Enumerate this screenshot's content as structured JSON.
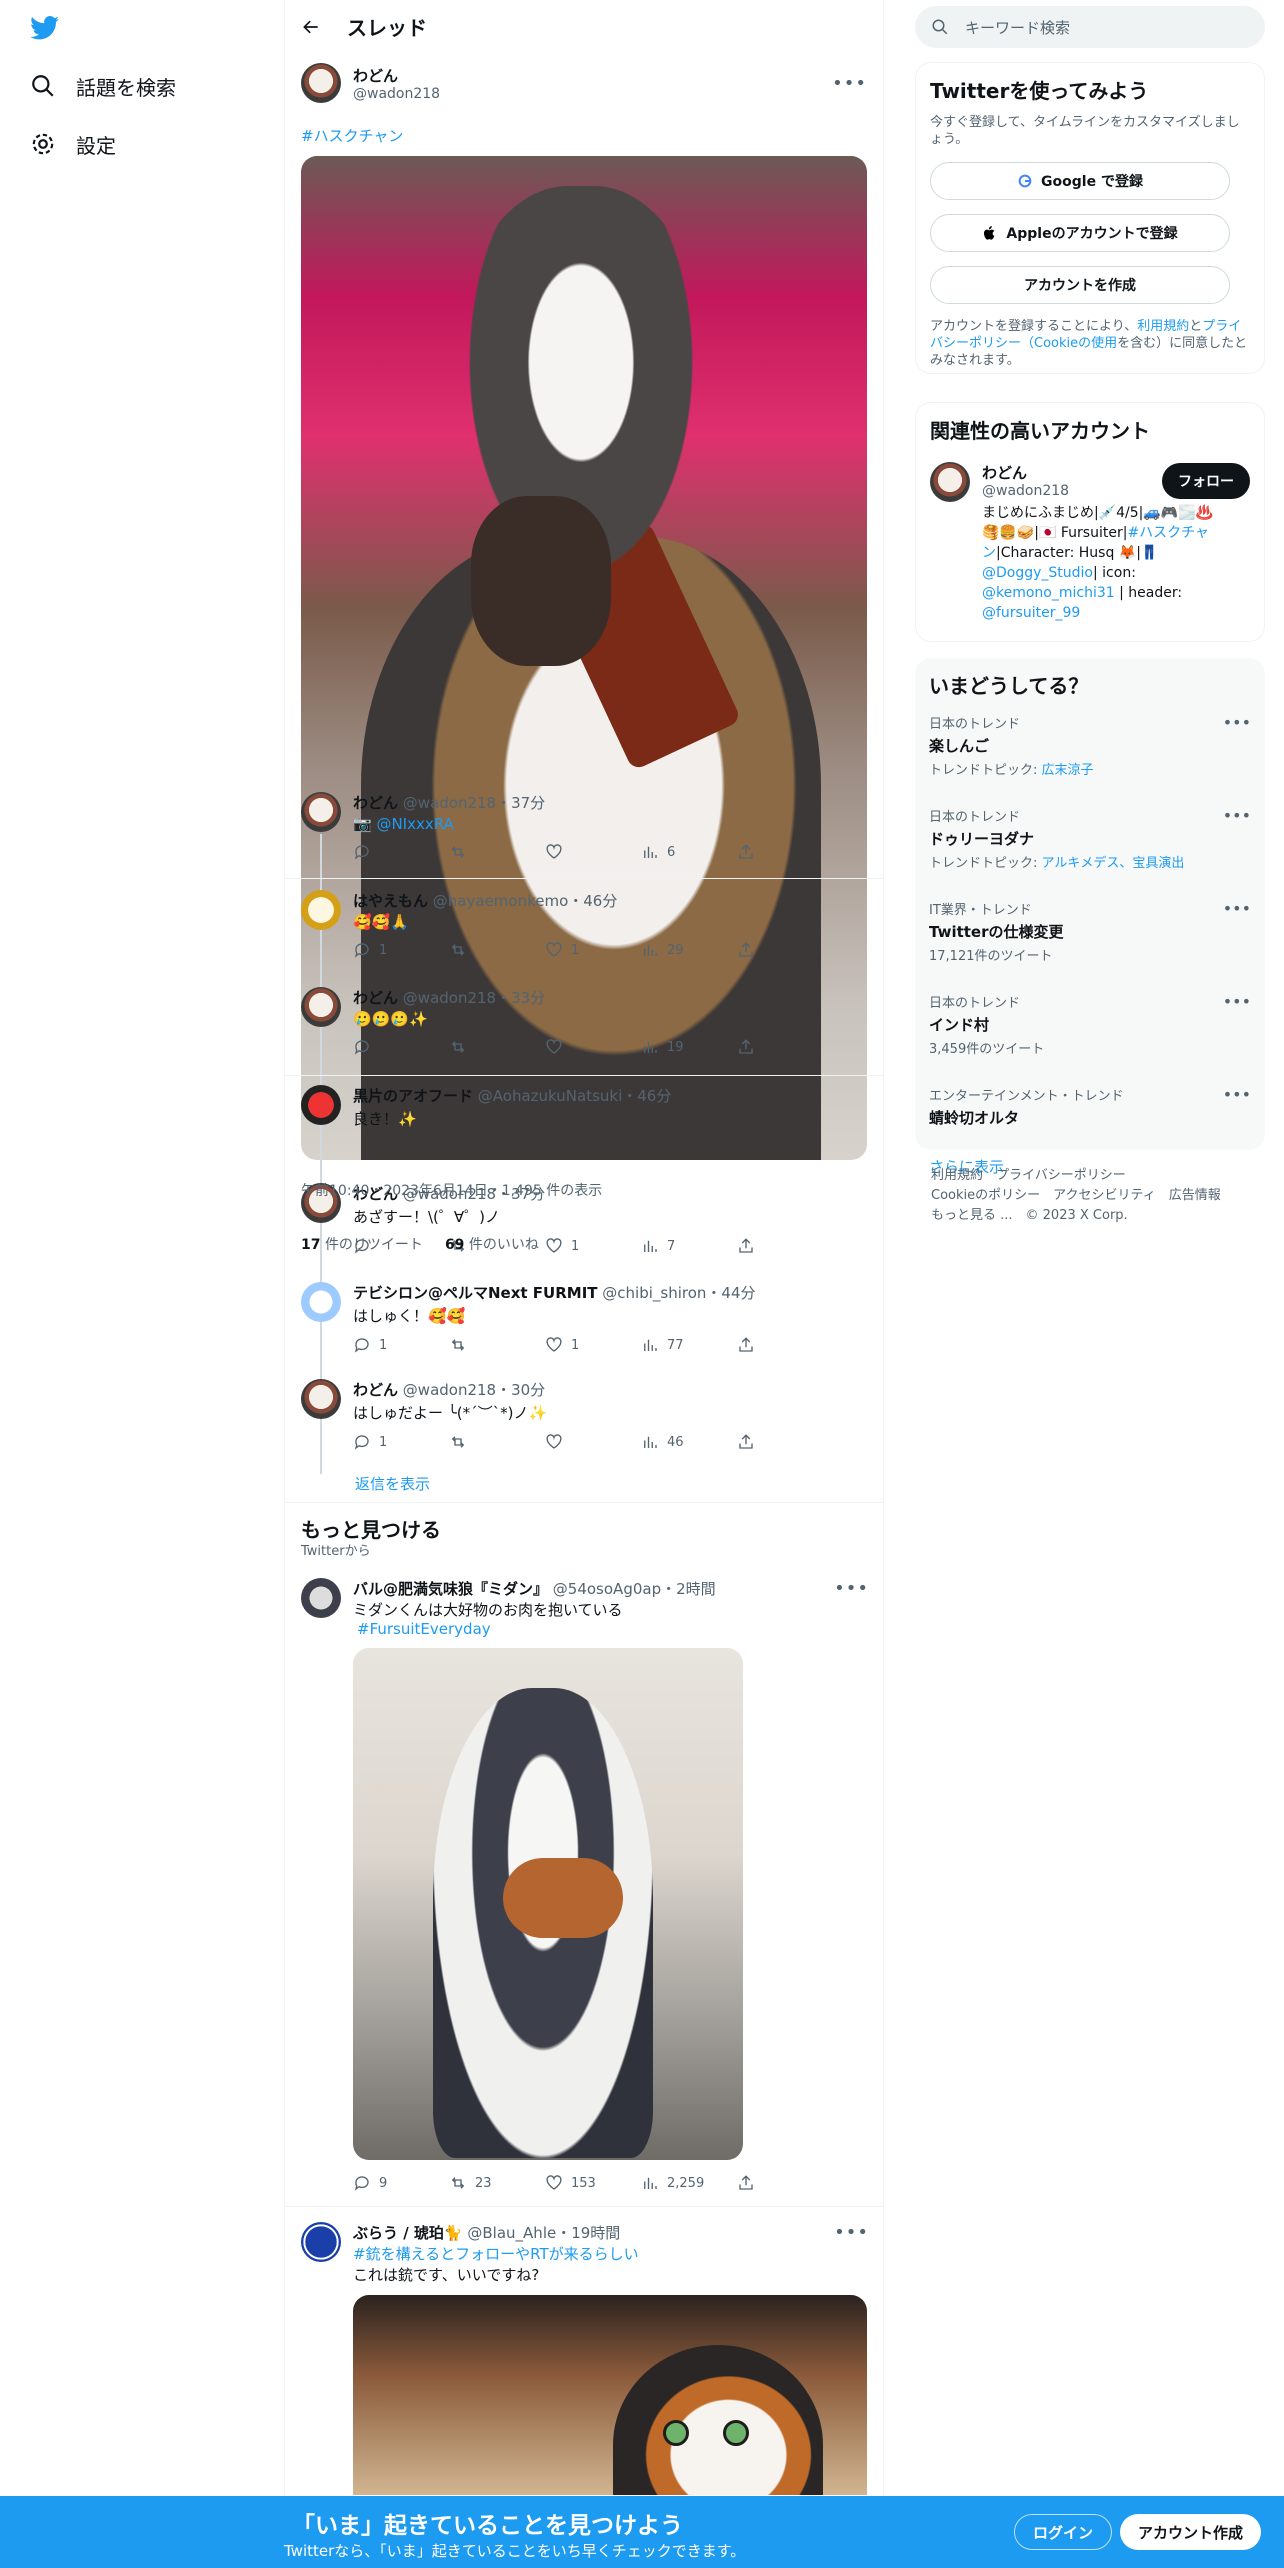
{
  "nav": {
    "explore_label": "話題を検索",
    "settings_label": "設定"
  },
  "thread": {
    "title": "スレッド",
    "author_name": "わどん",
    "author_handle": "@wadon218",
    "hashtag": "#ハスクチャン",
    "timestamp": "午前10:40・2023年6月14日・1,495 件の表示",
    "retweets_count": "17",
    "retweets_label": "件のリツイート",
    "likes_count": "69",
    "likes_label": "件のいいね"
  },
  "replies": [
    {
      "name": "わどん",
      "meta": "@wadon218・37分",
      "text": "📷 @NIxxxRA",
      "reply": "",
      "like": "",
      "views": "6"
    },
    {
      "name": "はやえもん",
      "meta": "@hayaemonkemo・46分",
      "text": "🥰🥰🙏",
      "reply": "1",
      "like": "1",
      "views": "29"
    },
    {
      "name": "わどん",
      "meta": "@wadon218・33分",
      "text": "🥲🥲🥲✨",
      "reply": "",
      "like": "",
      "views": "19"
    },
    {
      "name": "黒片のアオフード",
      "meta": "@AohazukuNatsuki・46分",
      "text": "良き！✨",
      "reply": "",
      "like": "",
      "views": ""
    },
    {
      "name": "わどん",
      "meta": "@wadon218・37分",
      "text": "あざすー！\\(゜∀゜)ノ",
      "reply": "",
      "like": "1",
      "views": "7"
    },
    {
      "name": "テビシロン@ペルマNext FURMIT",
      "meta": "@chibi_shiron・44分",
      "text": "はしゅく！🥰🥰",
      "reply": "1",
      "like": "1",
      "views": "77"
    },
    {
      "name": "わどん",
      "meta": "@wadon218・30分",
      "text": "はしゅだよー ╰(*´︶`*)ノ✨",
      "reply": "1",
      "like": "",
      "views": "46"
    }
  ],
  "show_replies": "返信を表示",
  "discover": {
    "title": "もっと見つける",
    "subtitle": "Twitterから",
    "tweets": [
      {
        "name": "バル@肥満気味狼『ミダン』",
        "meta": "@54osoAg0ap・2時間",
        "text": "ミダンくんは大好物のお肉を抱いている",
        "tag": "#FursuitEveryday",
        "reply": "9",
        "retweet": "23",
        "like": "153",
        "views": "2,259"
      },
      {
        "name": "ぶらう / 琥珀🐈",
        "meta": "@Blau_Ahle・19時間",
        "tag": "#銃を構えるとフォローやRTが来るらしい",
        "text": "これは銃です、いいですね?"
      }
    ]
  },
  "right": {
    "search_placeholder": "キーワード検索",
    "signup_card": {
      "title": "Twitterを使ってみよう",
      "desc": "今すぐ登録して、タイムラインをカスタマイズしましょう。",
      "google_btn": "Google で登録",
      "apple_btn": "Appleのアカウントで登録",
      "create_btn": "アカウントを作成",
      "legal_1": "アカウントを登録することにより、",
      "legal_terms": "利用規約",
      "legal_2": "と",
      "legal_privacy": "プライバシーポリシー（Cookieの使用",
      "legal_3": "を含む）に同意したとみなされます。"
    },
    "related": {
      "title": "関連性の高いアカウント",
      "name": "わどん",
      "handle": "@wadon218",
      "follow_btn": "フォロー",
      "bio_1": "まじめにふまじめ|💉4/5|🚙🎮🌫️♨️",
      "bio_2": "🥞🍔🥪|🇯🇵 Fursuiter|",
      "bio_tag": "#ハスクチャン",
      "bio_3": "|Character: Husq 🦊|👖",
      "bio_studio": "@Doggy_Studio",
      "bio_4": "| icon:",
      "bio_icon": "@kemono_michi31",
      "bio_5": "| header:",
      "bio_header": "@fursuiter_99"
    },
    "trends": {
      "title": "いまどうしてる？",
      "items": [
        {
          "cat": "日本のトレンド",
          "name": "楽しんご",
          "sub_label": "トレンドトピック: ",
          "sub_link": "広末涼子"
        },
        {
          "cat": "日本のトレンド",
          "name": "ドゥリーヨダナ",
          "sub_label": "トレンドトピック: ",
          "sub_link": "アルキメデス、宝具演出"
        },
        {
          "cat": "IT業界・トレンド",
          "name": "Twitterの仕様変更",
          "sub_label": "17,121件のツイート",
          "sub_link": ""
        },
        {
          "cat": "日本のトレンド",
          "name": "インド村",
          "sub_label": "3,459件のツイート",
          "sub_link": ""
        },
        {
          "cat": "エンターテインメント・トレンド",
          "name": "蜻蛉切オルタ",
          "sub_label": "",
          "sub_link": ""
        }
      ],
      "show_more": "さらに表示"
    },
    "footer": {
      "line1": "利用規約　プライバシーポリシー",
      "line2": "Cookieのポリシー　アクセシビリティ　広告情報",
      "line3": "もっと見る ...　© 2023 X Corp."
    }
  },
  "banner": {
    "title": "「いま」起きていることを見つけよう",
    "subtitle": "Twitterなら、「いま」起きていることをいち早くチェックできます。",
    "login": "ログイン",
    "signup": "アカウント作成"
  },
  "colors": {
    "accent": "#1d9bf0",
    "text": "#0f1419",
    "muted": "#536471"
  }
}
